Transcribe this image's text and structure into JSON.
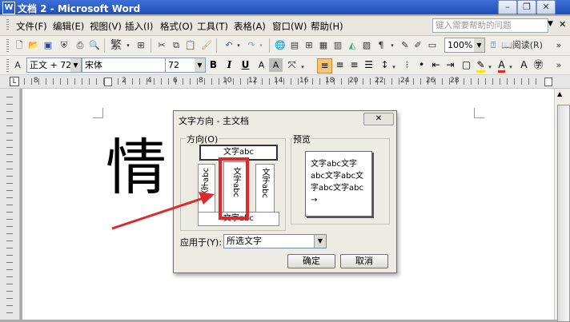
{
  "window": {
    "title": "文档 2 - Microsoft Word",
    "minimize": "–",
    "restore": "❐",
    "close": "✕"
  },
  "menu": {
    "items": [
      "文件(F)",
      "编辑(E)",
      "视图(V)",
      "插入(I)",
      "格式(O)",
      "工具(T)",
      "表格(A)",
      "窗口(W)",
      "帮助(H)"
    ],
    "help_search_placeholder": "键入需要帮助的问题"
  },
  "standard_toolbar": {
    "zoom": "100%",
    "read_label": "阅读(R)"
  },
  "formatting_toolbar": {
    "style": "正文 + 72",
    "font": "宋体",
    "size": "72",
    "bold": "B",
    "italic": "I",
    "underline": "U",
    "font_color_letter": "A"
  },
  "ruler": {
    "left_label": "8",
    "numbers": [
      "2",
      "4",
      "6",
      "8",
      "10",
      "12",
      "14",
      "16",
      "18",
      "20",
      "22",
      "24",
      "26",
      "28"
    ]
  },
  "document": {
    "visible_text": "情"
  },
  "dialog": {
    "title": "文字方向 - 主文档",
    "orientation_label": "方向(O)",
    "preview_label": "预览",
    "options": {
      "horizontal": "文字abc",
      "vertical_rtl": "文字abc",
      "vertical_selected": "文字abc",
      "vertical_right": "文字abc",
      "rotated_bottom": "文字abc"
    },
    "preview_lines": [
      "文字abc文字",
      "abc文字abc文",
      "字abc文字abc",
      "→"
    ],
    "apply_to_label": "应用于(Y):",
    "apply_to_value": "所选文字",
    "ok_label": "确定",
    "cancel_label": "取消"
  },
  "annotation": {
    "highlight_color": "#e0282b",
    "arrow_color": "#e0282b"
  }
}
